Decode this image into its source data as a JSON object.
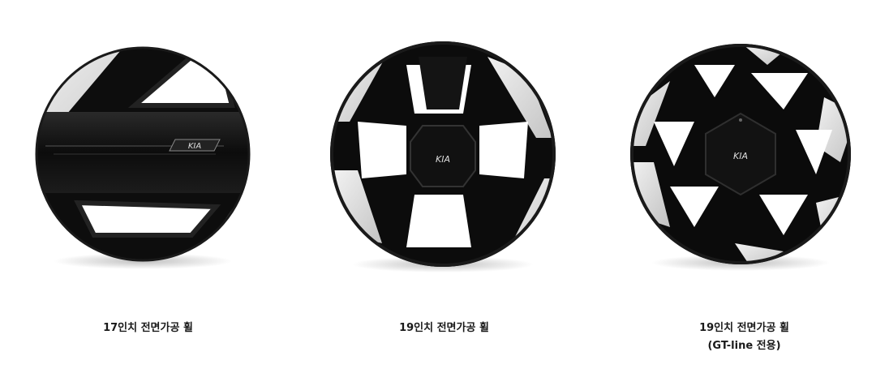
{
  "wheels": [
    {
      "caption": "17인치 전면가공 휠",
      "sub": "",
      "logo": "KIA"
    },
    {
      "caption": "19인치 전면가공 휠",
      "sub": "",
      "logo": "KIA"
    },
    {
      "caption": "19인치 전면가공 휠",
      "sub": "(GT-line 전용)",
      "logo": "KIA"
    }
  ],
  "colors": {
    "rim_dark": "#0b0b0b",
    "rim_silver": "#e4e4e4",
    "text": "#1a1a1a"
  }
}
